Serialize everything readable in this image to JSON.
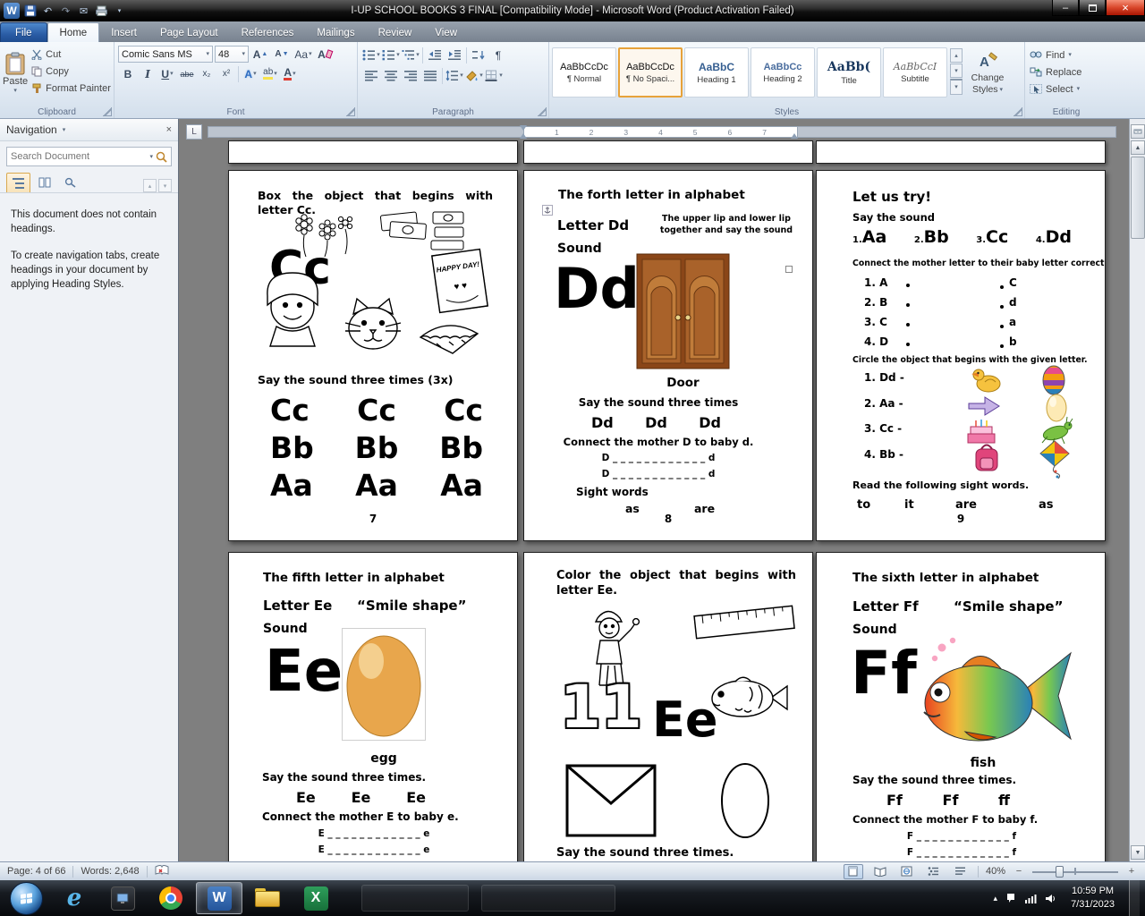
{
  "titlebar": {
    "title": "I-UP SCHOOL BOOKS 3 FINAL [Compatibility Mode]  -  Microsoft Word (Product Activation Failed)"
  },
  "icons": {
    "caret": "▾",
    "up_arrow": "▲",
    "down_arrow": "▼",
    "small_up": "▴",
    "small_down": "▾",
    "undo": "↶",
    "redo": "↷",
    "email": "✉",
    "letter_a": "A",
    "letter_aa": "Aa",
    "bold": "B",
    "italic": "I",
    "underline": "U",
    "strike": "abe",
    "subscript": "x₂",
    "superscript": "x²",
    "highlight": "ab",
    "pilcrow": "¶",
    "tab_stop": "L",
    "minimize": "–",
    "close": "×",
    "hearts": "♥ ♥",
    "minus": "−",
    "plus": "+",
    "e_logo": "e",
    "w_logo": "W",
    "x_logo": "X"
  },
  "ribbon": {
    "tabs": [
      "File",
      "Home",
      "Insert",
      "Page Layout",
      "References",
      "Mailings",
      "Review",
      "View"
    ],
    "clipboard": {
      "label": "Clipboard",
      "paste": "Paste",
      "cut": "Cut",
      "copy": "Copy",
      "format_painter": "Format Painter"
    },
    "font": {
      "label": "Font",
      "family": "Comic Sans MS",
      "size": "48"
    },
    "paragraph": {
      "label": "Paragraph"
    },
    "styles": {
      "label": "Styles",
      "change_styles_line1": "Change",
      "change_styles_line2": "Styles",
      "gallery": [
        {
          "sample": "AaBbCcDc",
          "name": "¶ Normal"
        },
        {
          "sample": "AaBbCcDc",
          "name": "¶ No Spaci..."
        },
        {
          "sample": "AaBbC",
          "name": "Heading 1"
        },
        {
          "sample": "AaBbCc",
          "name": "Heading 2"
        },
        {
          "sample": "AaBb(",
          "name": "Title"
        },
        {
          "sample": "AaBbCcI",
          "name": "Subtitle"
        }
      ]
    },
    "editing": {
      "label": "Editing",
      "find": "Find",
      "replace": "Replace",
      "select": "Select"
    }
  },
  "navigation_pane": {
    "title": "Navigation",
    "search_placeholder": "Search Document",
    "message1": "This document does not contain headings.",
    "message2": "To create navigation tabs, create headings in your document by applying Heading Styles."
  },
  "ruler": {
    "numbers": [
      "1",
      "2",
      "3",
      "4",
      "5",
      "6",
      "7"
    ]
  },
  "pages": {
    "p7": {
      "heading": "Box the object that begins with letter Cc.",
      "collage_letters": "Cc",
      "card_text": "HAPPY DAY!",
      "say": "Say the sound three times (3x)",
      "row1": [
        "Cc",
        "Cc",
        "Cc"
      ],
      "row2": [
        "Bb",
        "Bb",
        "Bb"
      ],
      "row3": [
        "Aa",
        "Aa",
        "Aa"
      ],
      "number": "7"
    },
    "p8": {
      "title": "The forth letter in alphabet",
      "letter": "Letter Dd",
      "tip": "The upper lip and lower lip together and say the sound",
      "sound": "Sound",
      "big": "Dd",
      "caption": "Door",
      "say": "Say the sound three times",
      "repeat": [
        "Dd",
        "Dd",
        "Dd"
      ],
      "connect": "Connect the mother D to baby d.",
      "trace": "D _ _ _ _ _ _ _ _ _ _ _ _ d",
      "sight_label": "Sight words",
      "sight": [
        "as",
        "are"
      ],
      "number": "8"
    },
    "p9": {
      "title": "Let us try!",
      "subtitle": "Say the sound",
      "letters": [
        {
          "n": "1.",
          "l": "Aa"
        },
        {
          "n": "2.",
          "l": "Bb"
        },
        {
          "n": "3.",
          "l": "Cc"
        },
        {
          "n": "4.",
          "l": "Dd"
        }
      ],
      "connect": "Connect the mother letter to their baby letter correctly.",
      "match_left": [
        "1. A",
        "2. B",
        "3. C",
        "4. D"
      ],
      "match_right": [
        "C",
        "d",
        "a",
        "b"
      ],
      "circle": "Circle the object that begins with the given letter.",
      "circle_items": [
        "1. Dd -",
        "2. Aa -",
        "3. Cc -",
        "4. Bb -"
      ],
      "read": "Read the following sight words.",
      "sight": [
        "to",
        "it",
        "are",
        "as"
      ],
      "number": "9"
    },
    "p10": {
      "title": "The fifth letter in alphabet",
      "letter": "Letter Ee",
      "shape": "“Smile shape”",
      "sound": "Sound",
      "big": "Ee",
      "caption": "egg",
      "say": "Say the sound three times.",
      "repeat": [
        "Ee",
        "Ee",
        "Ee"
      ],
      "connect": "Connect the mother E to baby e.",
      "trace": "E _ _ _ _ _ _ _ _ _ _ _ _ e"
    },
    "p11": {
      "heading": "Color the object that begins with letter Ee.",
      "numbers": "11",
      "letters": "Ee",
      "say": "Say the sound three times."
    },
    "p12": {
      "title": "The sixth letter in alphabet",
      "letter": "Letter Ff",
      "shape": "“Smile shape”",
      "sound": "Sound",
      "big": "Ff",
      "caption": "fish",
      "say": "Say the sound three times.",
      "repeat": [
        "Ff",
        "Ff",
        "ff"
      ],
      "connect": "Connect the mother F to baby f.",
      "trace": "F _ _ _ _ _ _ _ _ _ _ _ _ f"
    }
  },
  "status_bar": {
    "page": "Page: 4 of 66",
    "words": "Words: 2,648",
    "zoom": "40%"
  },
  "taskbar": {
    "time": "10:59 PM",
    "date": "7/31/2023"
  }
}
